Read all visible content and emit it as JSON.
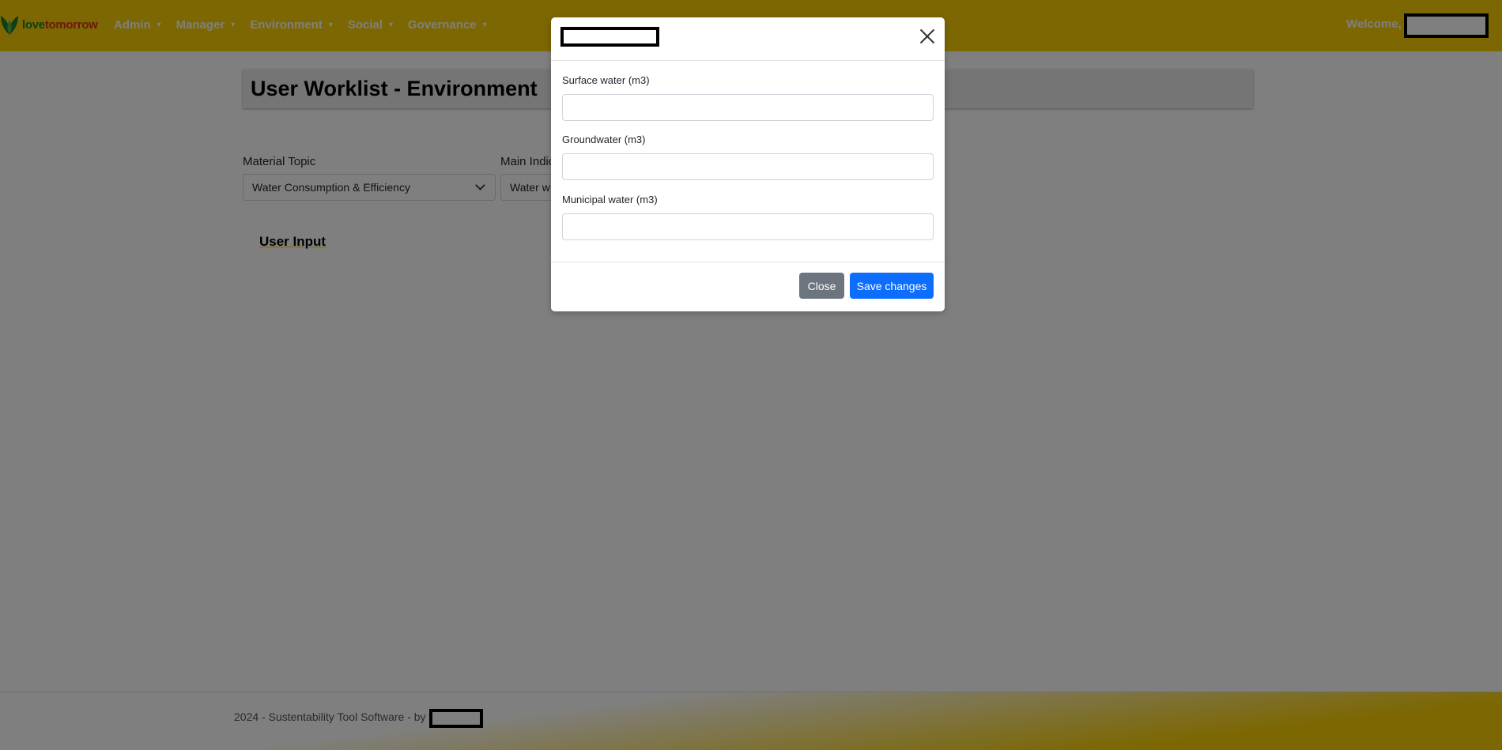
{
  "navbar": {
    "logo": {
      "word1": "love",
      "word2": "tomorrow"
    },
    "menu": [
      {
        "label": "Admin"
      },
      {
        "label": "Manager"
      },
      {
        "label": "Environment"
      },
      {
        "label": "Social"
      },
      {
        "label": "Governance"
      }
    ],
    "welcome": "Welcome,"
  },
  "page": {
    "title": "User Worklist - Environment",
    "filters": {
      "material_topic": {
        "label": "Material Topic",
        "value": "Water Consumption & Efficiency"
      },
      "main_indicator": {
        "label": "Main Indic",
        "value": "Water w"
      }
    },
    "section": "User Input"
  },
  "footer": {
    "text": "2024 - Sustentability Tool Software - by"
  },
  "modal": {
    "fields": [
      {
        "label": "Surface water (m3)",
        "value": ""
      },
      {
        "label": "Groundwater (m3)",
        "value": ""
      },
      {
        "label": "Municipal water (m3)",
        "value": ""
      }
    ],
    "buttons": {
      "close": "Close",
      "save": "Save changes"
    }
  },
  "colors": {
    "brand_yellow": "#f9cf04",
    "primary_button": "#0d6efd",
    "secondary_button": "#6c757d",
    "logo_green": "#1e7d32",
    "logo_red": "#d9321a"
  }
}
